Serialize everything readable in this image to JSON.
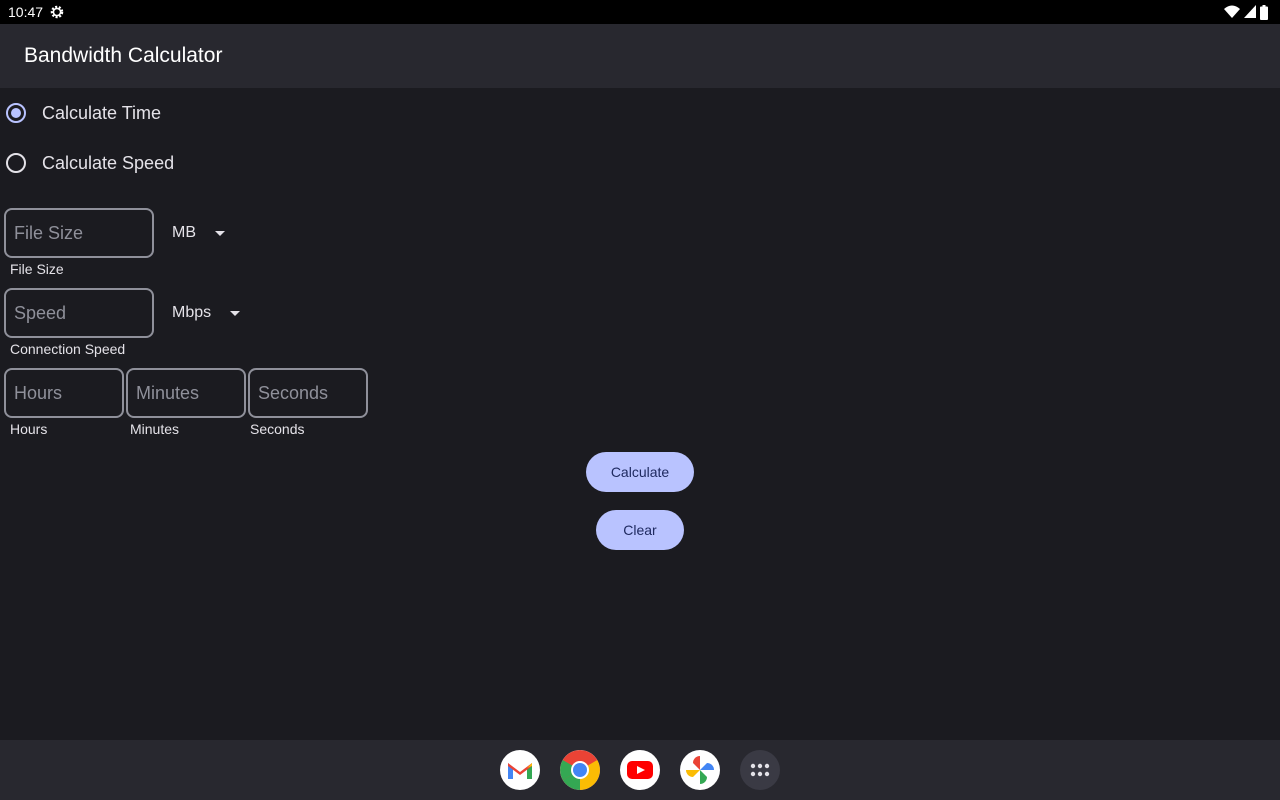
{
  "status_bar": {
    "time": "10:47",
    "icons": [
      "settings-gear-icon",
      "wifi-icon",
      "cell-signal-icon",
      "battery-icon"
    ]
  },
  "app_bar": {
    "title": "Bandwidth Calculator"
  },
  "mode": {
    "options": [
      {
        "label": "Calculate Time",
        "checked": true
      },
      {
        "label": "Calculate Speed",
        "checked": false
      }
    ]
  },
  "file_size": {
    "placeholder": "File Size",
    "value": "",
    "helper": "File Size",
    "unit": "MB"
  },
  "speed": {
    "placeholder": "Speed",
    "value": "",
    "helper": "Connection Speed",
    "unit": "Mbps"
  },
  "time": {
    "hours": {
      "placeholder": "Hours",
      "value": "",
      "helper": "Hours"
    },
    "minutes": {
      "placeholder": "Minutes",
      "value": "",
      "helper": "Minutes"
    },
    "seconds": {
      "placeholder": "Seconds",
      "value": "",
      "helper": "Seconds"
    }
  },
  "actions": {
    "calculate_label": "Calculate",
    "clear_label": "Clear"
  },
  "dock": {
    "apps": [
      "gmail-icon",
      "chrome-icon",
      "youtube-icon",
      "photos-icon",
      "app-drawer-icon"
    ]
  },
  "colors": {
    "background": "#1b1b20",
    "app_bar": "#28282f",
    "accent": "#b9c3ff",
    "outline": "#8f909a"
  }
}
